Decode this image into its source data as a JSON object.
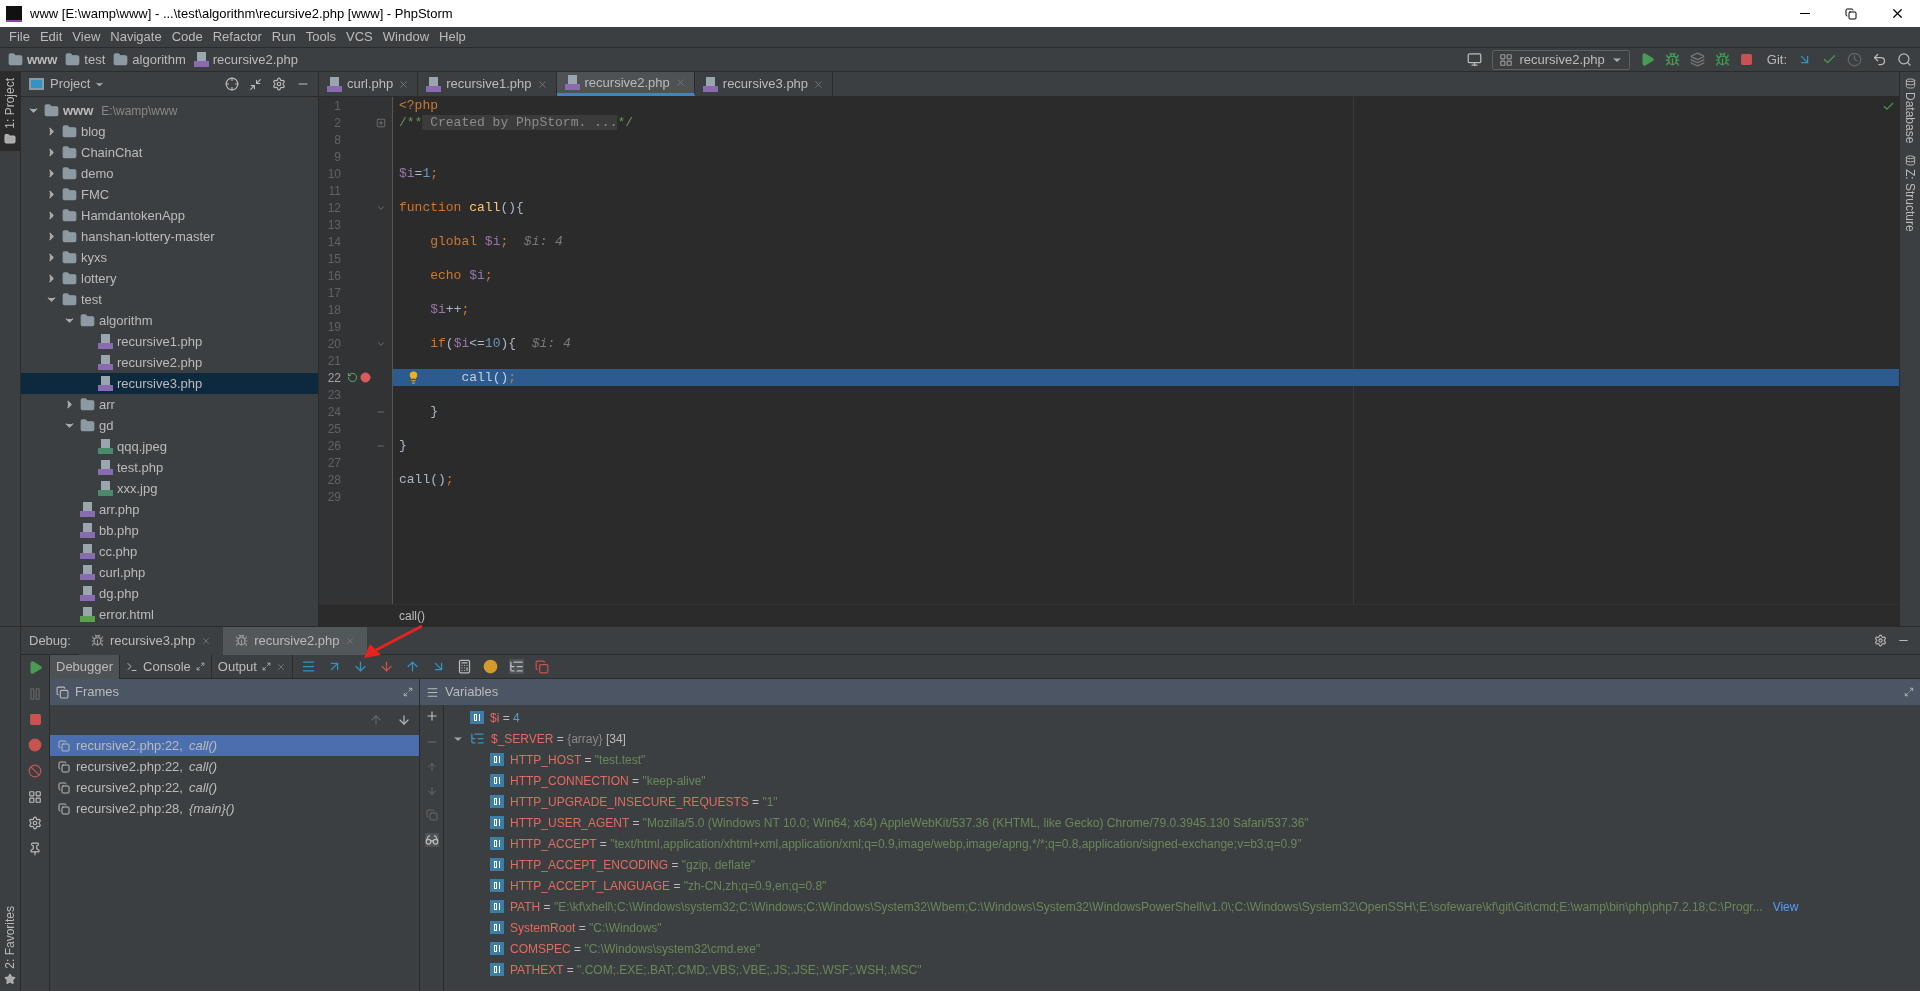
{
  "window": {
    "title": "www [E:\\wamp\\www] - ...\\test\\algorithm\\recursive2.php [www] - PhpStorm"
  },
  "menu": [
    "File",
    "Edit",
    "View",
    "Navigate",
    "Code",
    "Refactor",
    "Run",
    "Tools",
    "VCS",
    "Window",
    "Help"
  ],
  "breadcrumb": [
    {
      "label": "www",
      "kind": "folder"
    },
    {
      "label": "test",
      "kind": "folder"
    },
    {
      "label": "algorithm",
      "kind": "folder"
    },
    {
      "label": "recursive2.php",
      "kind": "php"
    }
  ],
  "run_config": {
    "label": "recursive2.php"
  },
  "git_label": "Git:",
  "side_stripes": {
    "left_top": "1: Project",
    "left_bottom": "2: Favorites",
    "right": [
      "Database",
      "Z: Structure"
    ]
  },
  "project": {
    "title": "Project",
    "tree": [
      {
        "name": "www",
        "path": "E:\\wamp\\www",
        "kind": "folder",
        "expanded": true,
        "selected": false,
        "children": [
          {
            "name": "blog",
            "kind": "folder",
            "expanded": false,
            "selected": false
          },
          {
            "name": "ChainChat",
            "kind": "folder",
            "expanded": false,
            "selected": false
          },
          {
            "name": "demo",
            "kind": "folder",
            "expanded": false,
            "selected": false
          },
          {
            "name": "FMC",
            "kind": "folder",
            "expanded": false,
            "selected": false
          },
          {
            "name": "HamdantokenApp",
            "kind": "folder",
            "expanded": false,
            "selected": false
          },
          {
            "name": "hanshan-lottery-master",
            "kind": "folder",
            "expanded": false,
            "selected": false
          },
          {
            "name": "kyxs",
            "kind": "folder",
            "expanded": false,
            "selected": false
          },
          {
            "name": "lottery",
            "kind": "folder",
            "expanded": false,
            "selected": false
          },
          {
            "name": "test",
            "kind": "folder",
            "expanded": true,
            "selected": false,
            "children": [
              {
                "name": "algorithm",
                "kind": "folder",
                "expanded": true,
                "selected": false,
                "children": [
                  {
                    "name": "recursive1.php",
                    "kind": "php",
                    "selected": false
                  },
                  {
                    "name": "recursive2.php",
                    "kind": "php",
                    "selected": false
                  },
                  {
                    "name": "recursive3.php",
                    "kind": "php",
                    "selected": true
                  }
                ]
              },
              {
                "name": "arr",
                "kind": "folder",
                "expanded": false,
                "selected": false
              },
              {
                "name": "gd",
                "kind": "folder",
                "expanded": true,
                "selected": false,
                "children": [
                  {
                    "name": "qqq.jpeg",
                    "kind": "image",
                    "selected": false
                  },
                  {
                    "name": "test.php",
                    "kind": "php",
                    "selected": false
                  },
                  {
                    "name": "xxx.jpg",
                    "kind": "image",
                    "selected": false
                  }
                ]
              },
              {
                "name": "arr.php",
                "kind": "php",
                "selected": false
              },
              {
                "name": "bb.php",
                "kind": "php",
                "selected": false
              },
              {
                "name": "cc.php",
                "kind": "php",
                "selected": false
              },
              {
                "name": "curl.php",
                "kind": "php",
                "selected": false
              },
              {
                "name": "dg.php",
                "kind": "php",
                "selected": false
              },
              {
                "name": "error.html",
                "kind": "html",
                "selected": false
              }
            ]
          }
        ]
      }
    ]
  },
  "editor": {
    "tabs": [
      {
        "label": "curl.php",
        "selected": false
      },
      {
        "label": "recursive1.php",
        "selected": false
      },
      {
        "label": "recursive2.php",
        "selected": true
      },
      {
        "label": "recursive3.php",
        "selected": false
      }
    ],
    "lines": [
      {
        "number": "1",
        "current": false,
        "breakpoint": false,
        "tokens": [
          {
            "kind": "keyword",
            "text": "<?php"
          }
        ]
      },
      {
        "number": "2",
        "current": false,
        "breakpoint": false,
        "fold": {
          "kind": "expand"
        },
        "tokens": [
          {
            "kind": "comment",
            "text": "/**"
          },
          {
            "kind": "folded",
            "text": " Created by PhpStorm. ..."
          },
          {
            "kind": "comment",
            "text": "*/"
          }
        ]
      },
      {
        "number": "8",
        "current": false,
        "breakpoint": false
      },
      {
        "number": "9",
        "current": false,
        "breakpoint": false
      },
      {
        "number": "10",
        "current": false,
        "breakpoint": false,
        "tokens": [
          {
            "kind": "variable",
            "text": "$i"
          },
          {
            "kind": "plain",
            "text": "="
          },
          {
            "kind": "number",
            "text": "1"
          },
          {
            "kind": "keyword",
            "text": ";"
          }
        ]
      },
      {
        "number": "11",
        "current": false,
        "breakpoint": false
      },
      {
        "number": "12",
        "current": false,
        "breakpoint": false,
        "fold": {
          "kind": "start"
        },
        "tokens": [
          {
            "kind": "keyword",
            "text": "function "
          },
          {
            "kind": "function",
            "text": "call"
          },
          {
            "kind": "plain",
            "text": "(){"
          }
        ]
      },
      {
        "number": "13",
        "current": false,
        "breakpoint": false
      },
      {
        "number": "14",
        "current": false,
        "breakpoint": false,
        "tokens": [
          {
            "kind": "keyword",
            "text": "    global "
          },
          {
            "kind": "variable",
            "text": "$i"
          },
          {
            "kind": "keyword",
            "text": ";"
          },
          {
            "kind": "hint",
            "text": "  $i: 4"
          }
        ]
      },
      {
        "number": "15",
        "current": false,
        "breakpoint": false
      },
      {
        "number": "16",
        "current": false,
        "breakpoint": false,
        "tokens": [
          {
            "kind": "keyword",
            "text": "    echo "
          },
          {
            "kind": "variable",
            "text": "$i"
          },
          {
            "kind": "keyword",
            "text": ";"
          }
        ]
      },
      {
        "number": "17",
        "current": false,
        "breakpoint": false
      },
      {
        "number": "18",
        "current": false,
        "breakpoint": false,
        "tokens": [
          {
            "kind": "variable",
            "text": "    $i"
          },
          {
            "kind": "plain",
            "text": "++"
          },
          {
            "kind": "keyword",
            "text": ";"
          }
        ]
      },
      {
        "number": "19",
        "current": false,
        "breakpoint": false
      },
      {
        "number": "20",
        "current": false,
        "breakpoint": false,
        "fold": {
          "kind": "start"
        },
        "tokens": [
          {
            "kind": "keyword",
            "text": "    if"
          },
          {
            "kind": "plain",
            "text": "("
          },
          {
            "kind": "variable",
            "text": "$i"
          },
          {
            "kind": "plain",
            "text": "<="
          },
          {
            "kind": "number",
            "text": "10"
          },
          {
            "kind": "plain",
            "text": "){"
          },
          {
            "kind": "hint",
            "text": "  $i: 4"
          }
        ]
      },
      {
        "number": "21",
        "current": false,
        "breakpoint": false
      },
      {
        "number": "22",
        "current": true,
        "breakpoint": true,
        "tokens": [
          {
            "kind": "plain",
            "text": "        call()"
          },
          {
            "kind": "keyword",
            "text": ";"
          }
        ]
      },
      {
        "number": "23",
        "current": false,
        "breakpoint": false
      },
      {
        "number": "24",
        "current": false,
        "breakpoint": false,
        "fold": {
          "kind": "end"
        },
        "tokens": [
          {
            "kind": "plain",
            "text": "    }"
          }
        ]
      },
      {
        "number": "25",
        "current": false,
        "breakpoint": false
      },
      {
        "number": "26",
        "current": false,
        "breakpoint": false,
        "fold": {
          "kind": "end"
        },
        "tokens": [
          {
            "kind": "plain",
            "text": "}"
          }
        ]
      },
      {
        "number": "27",
        "current": false,
        "breakpoint": false
      },
      {
        "number": "28",
        "current": false,
        "breakpoint": false,
        "tokens": [
          {
            "kind": "plain",
            "text": "call()"
          },
          {
            "kind": "keyword",
            "text": ";"
          }
        ]
      },
      {
        "number": "29",
        "current": false,
        "breakpoint": false
      }
    ],
    "context": "call()"
  },
  "debug": {
    "label": "Debug:",
    "sessions": [
      {
        "label": "recursive3.php",
        "selected": false
      },
      {
        "label": "recursive2.php",
        "selected": true
      }
    ],
    "tabs": [
      {
        "label": "Debugger",
        "kind": "plain",
        "selected": true
      },
      {
        "label": "Console",
        "kind": "console",
        "selected": false
      },
      {
        "label": "Output",
        "kind": "output",
        "selected": false
      }
    ],
    "frames_title": "Frames",
    "frames": [
      {
        "location": "recursive2.php:22,",
        "function": "call()",
        "selected": true
      },
      {
        "location": "recursive2.php:22,",
        "function": "call()",
        "selected": false
      },
      {
        "location": "recursive2.php:22,",
        "function": "call()",
        "selected": false
      },
      {
        "location": "recursive2.php:28,",
        "function": "{main}()",
        "selected": false
      }
    ],
    "variables_title": "Variables",
    "variables": [
      {
        "name": "$i",
        "operator": "=",
        "value": "4",
        "kind": "number"
      },
      {
        "name": "$_SERVER",
        "operator": "=",
        "type": "{array}",
        "value": "[34]",
        "kind": "array",
        "expanded": true,
        "children": [
          {
            "name": "HTTP_HOST",
            "operator": "=",
            "value": "\"test.test\"",
            "kind": "string"
          },
          {
            "name": "HTTP_CONNECTION",
            "operator": "=",
            "value": "\"keep-alive\"",
            "kind": "string"
          },
          {
            "name": "HTTP_UPGRADE_INSECURE_REQUESTS",
            "operator": "=",
            "value": "\"1\"",
            "kind": "string"
          },
          {
            "name": "HTTP_USER_AGENT",
            "operator": "=",
            "value": "\"Mozilla/5.0 (Windows NT 10.0; Win64; x64) AppleWebKit/537.36 (KHTML, like Gecko) Chrome/79.0.3945.130 Safari/537.36\"",
            "kind": "string"
          },
          {
            "name": "HTTP_ACCEPT",
            "operator": "=",
            "value": "\"text/html,application/xhtml+xml,application/xml;q=0.9,image/webp,image/apng,*/*;q=0.8,application/signed-exchange;v=b3;q=0.9\"",
            "kind": "string"
          },
          {
            "name": "HTTP_ACCEPT_ENCODING",
            "operator": "=",
            "value": "\"gzip, deflate\"",
            "kind": "string"
          },
          {
            "name": "HTTP_ACCEPT_LANGUAGE",
            "operator": "=",
            "value": "\"zh-CN,zh;q=0.9,en;q=0.8\"",
            "kind": "string"
          },
          {
            "name": "PATH",
            "operator": "=",
            "value": "\"E:\\kf\\xhell\\;C:\\Windows\\system32;C:\\Windows;C:\\Windows\\System32\\Wbem;C:\\Windows\\System32\\WindowsPowerShell\\v1.0\\;C:\\Windows\\System32\\OpenSSH\\;E:\\sofeware\\kf\\git\\Git\\cmd;E:\\wamp\\bin\\php\\php7.2.18;C:\\Progr...",
            "kind": "string",
            "link": "View"
          },
          {
            "name": "SystemRoot",
            "operator": "=",
            "value": "\"C:\\Windows\"",
            "kind": "string"
          },
          {
            "name": "COMSPEC",
            "operator": "=",
            "value": "\"C:\\Windows\\system32\\cmd.exe\"",
            "kind": "string"
          },
          {
            "name": "PATHEXT",
            "operator": "=",
            "value": "\".COM;.EXE;.BAT;.CMD;.VBS;.VBE;.JS;.JSE;.WSF;.WSH;.MSC\"",
            "kind": "string"
          }
        ]
      }
    ]
  }
}
